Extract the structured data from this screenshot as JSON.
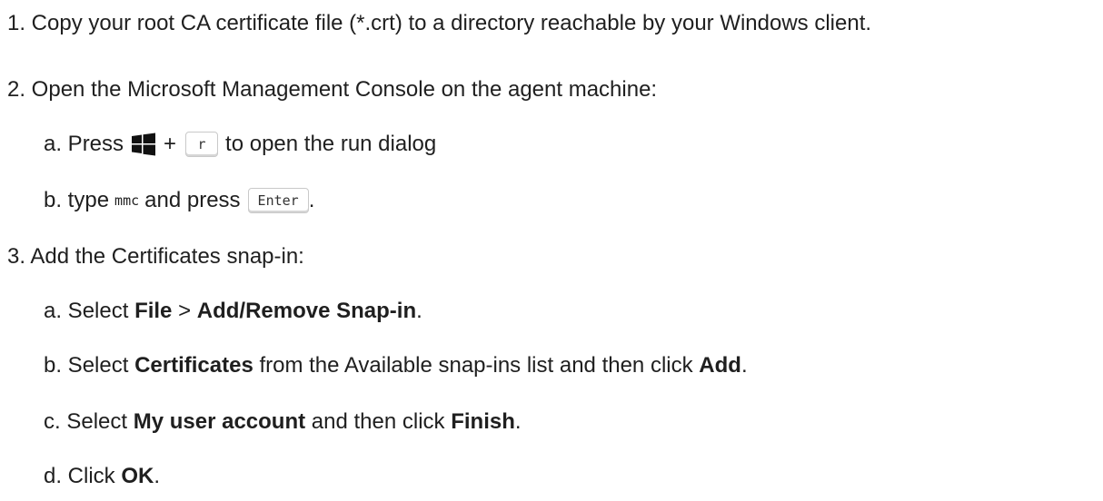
{
  "steps": {
    "s1": {
      "text": "1. Copy your root CA certificate file (*.crt) to a directory reachable by your Windows client."
    },
    "s2": {
      "text": "2. Open the Microsoft Management Console on the agent machine:",
      "a": {
        "prefix": "a. Press",
        "plus": "+",
        "key": "r",
        "suffix": "to open the run dialog",
        "icon": "windows-key-icon"
      },
      "b": {
        "prefix": "b. type",
        "code": "mmc",
        "middle": "and press",
        "key": "Enter",
        "suffix": "."
      }
    },
    "s3": {
      "text": "3. Add the Certificates snap-in:",
      "a": {
        "prefix": "a. Select ",
        "bold1": "File",
        "sep": " > ",
        "bold2": "Add/Remove Snap-in",
        "suffix": "."
      },
      "b": {
        "prefix": "b. Select ",
        "bold1": "Certificates",
        "middle": " from the Available snap-ins list and then click ",
        "bold2": "Add",
        "suffix": "."
      },
      "c": {
        "prefix": "c. Select ",
        "bold1": "My user account",
        "middle": " and then click ",
        "bold2": "Finish",
        "suffix": "."
      },
      "d": {
        "prefix": "d. Click ",
        "bold1": "OK",
        "suffix": "."
      }
    }
  }
}
